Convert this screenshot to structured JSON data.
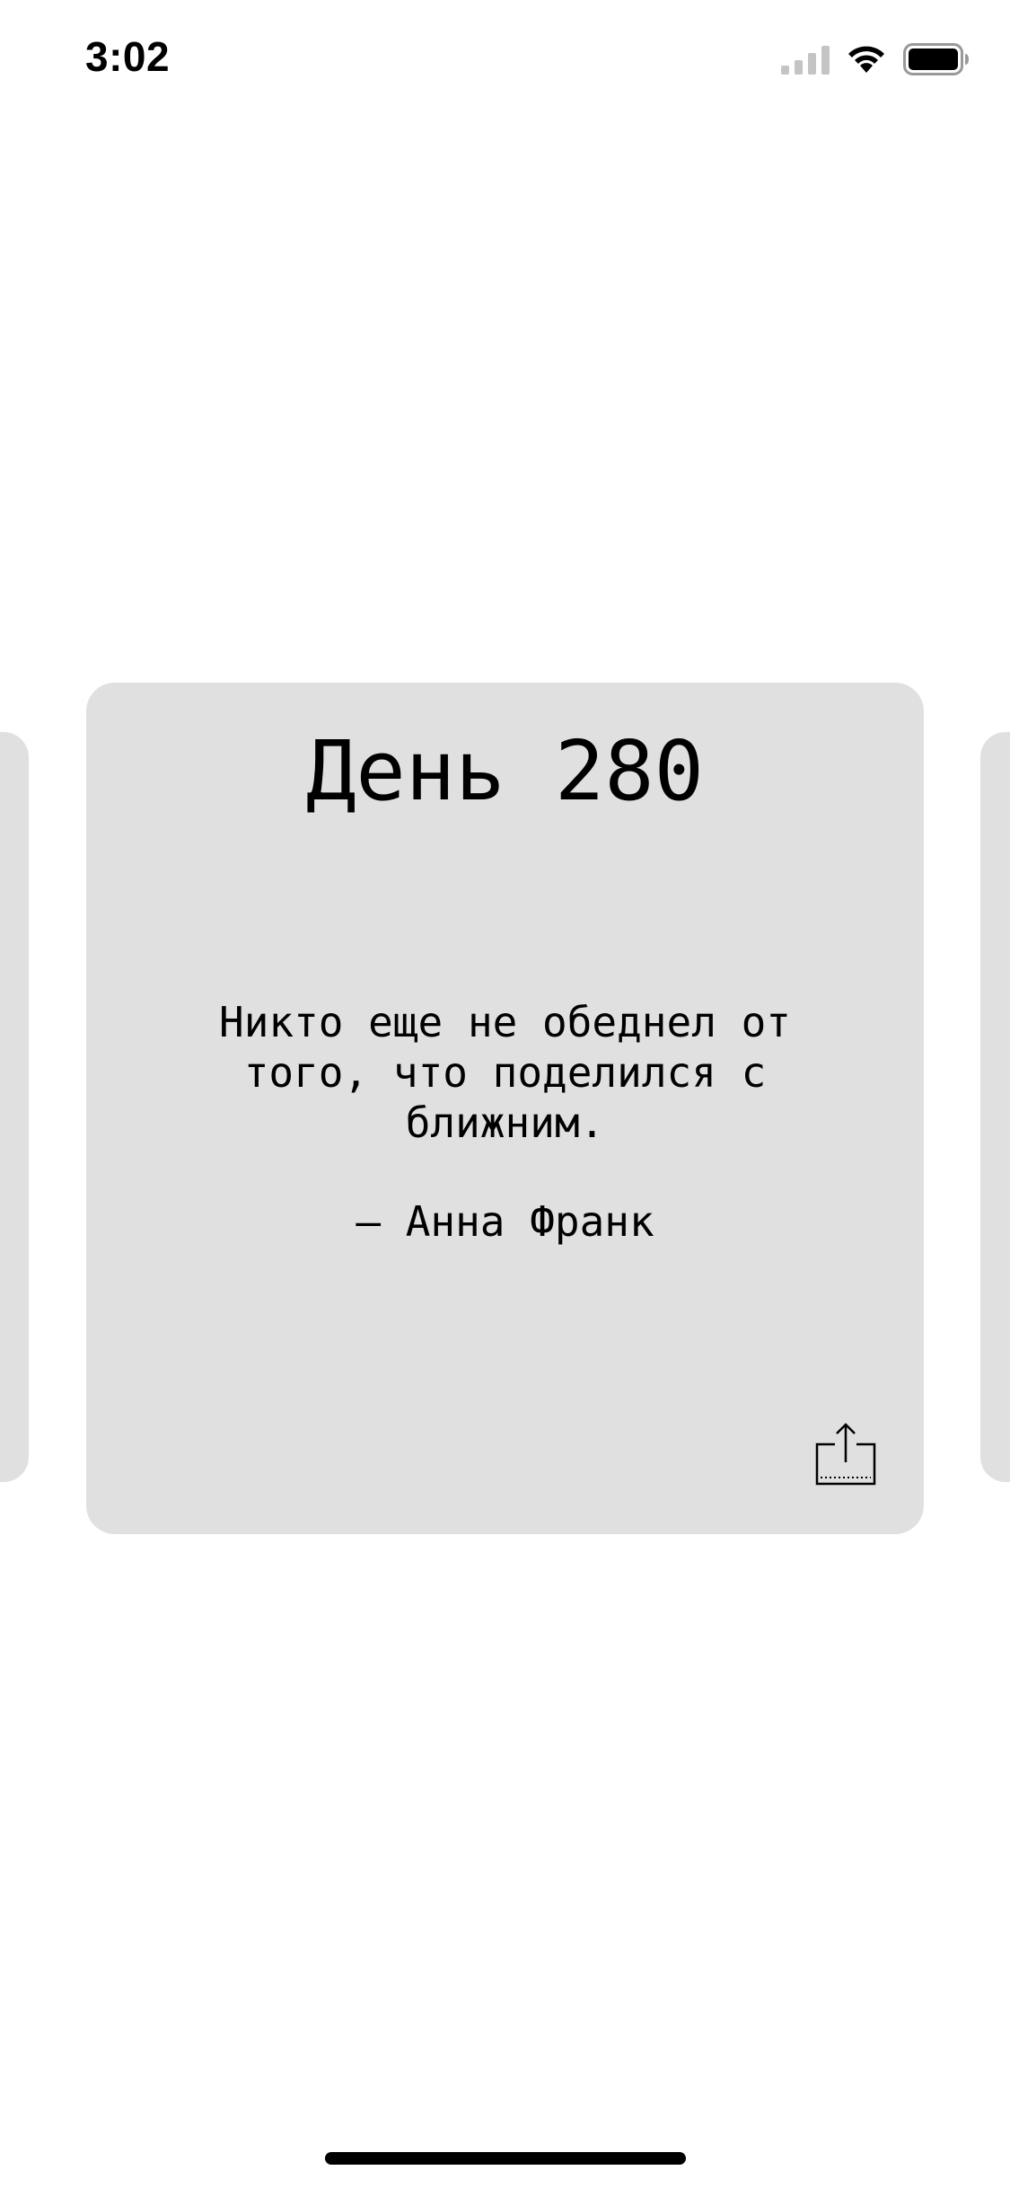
{
  "status_bar": {
    "time": "3:02",
    "icons": [
      "cellular-signal-icon",
      "wifi-icon",
      "battery-icon"
    ]
  },
  "card": {
    "day_title": "День 280",
    "quote": "Никто еще не обеднел от того, что поделился с ближним.",
    "author": "— Анна Франк",
    "share_icon": "share-icon"
  },
  "colors": {
    "background": "#ffffff",
    "card": "#e0e0e0",
    "text": "#000000"
  }
}
